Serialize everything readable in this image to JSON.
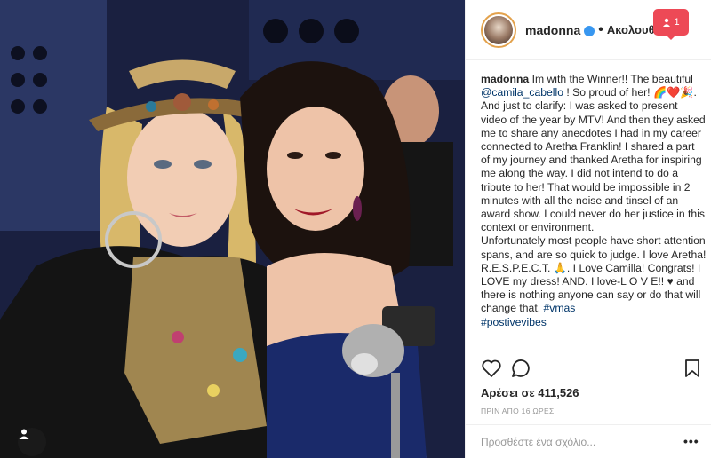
{
  "post": {
    "username": "madonna",
    "follow_label": "Ακολουθείτε",
    "separator": "•",
    "notification_count": "1",
    "caption": {
      "username": "madonna",
      "part1": "Im with the Winner!! The beautiful ",
      "mention": "@camila_cabello",
      "part2": " ! So proud of her! 🌈❤️🎉. And just to clarify: I was asked to present video of the year by MTV! And then they asked me to share any anecdotes I had in my career connected to Aretha Franklin! I shared a part of my journey and thanked Aretha for inspiring me along the way. I did not intend to do a tribute to her! That would be impossible in 2 minutes with all the noise and tinsel of an award show. I could never do her justice in this context or environment.",
      "part3": "Unfortunately most people have short attention spans, and are so quick to judge. I love Aretha! R.E.S.P.E.C.T. 🙏. I Love Camilla! Congrats! I LOVE my dress! AND. I love-L O V E!! ♥ and there is nothing anyone can say or do that will change that. ",
      "hashtag1": "#vmas",
      "hashtag2": "#postivevibes"
    },
    "likes_text": "Αρέσει σε 411,526",
    "timestamp": "ΠΡΙΝ ΑΠΟ 16 ΩΡΕΣ",
    "comment_placeholder": "Προσθέστε ένα σχόλιο...",
    "more_label": "•••"
  },
  "icons": {
    "like": "heart-icon",
    "comment": "comment-icon",
    "save": "bookmark-icon",
    "user_tag": "user-icon",
    "notification": "person-icon"
  },
  "colors": {
    "link": "#003569",
    "notification": "#ed4956",
    "verified": "#3897f0",
    "muted": "#999999"
  }
}
